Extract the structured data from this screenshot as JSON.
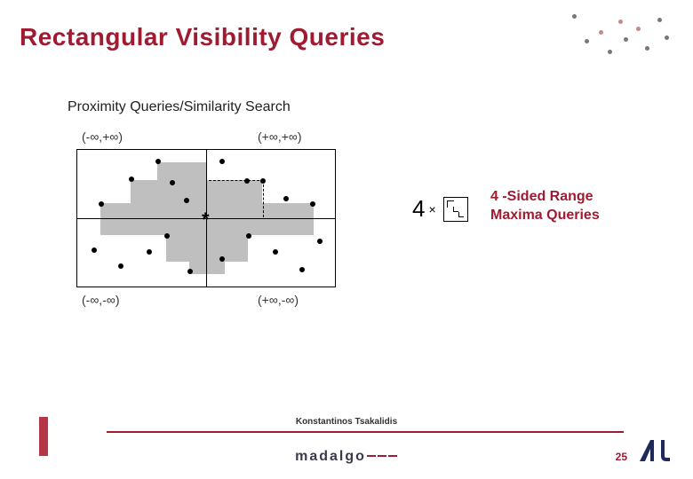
{
  "title": "Rectangular Visibility Queries",
  "subtitle": "Proximity Queries/Similarity Search",
  "quadrants": {
    "top_left": "(-∞,+∞)",
    "top_right": "(+∞,+∞)",
    "bottom_left": "(-∞,-∞)",
    "bottom_right": "(+∞,-∞)"
  },
  "annotation": {
    "count": "4",
    "times": "×",
    "label_line1": "4 -Sided Range",
    "label_line2": "Maxima Queries"
  },
  "footer": {
    "author": "Konstantinos Tsakalidis",
    "wordmark": "madalgo",
    "page": "25"
  },
  "colors": {
    "accent": "#9e1b32"
  }
}
